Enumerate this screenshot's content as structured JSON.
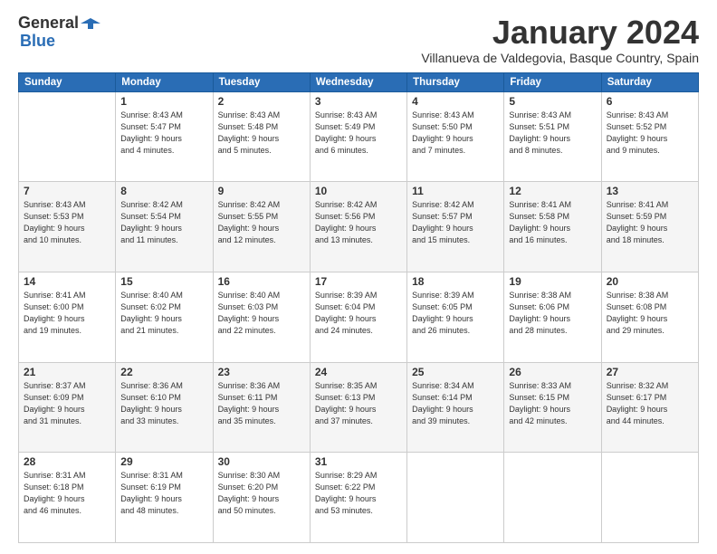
{
  "logo": {
    "line1": "General",
    "line2": "Blue"
  },
  "title": "January 2024",
  "subtitle": "Villanueva de Valdegovia, Basque Country, Spain",
  "headers": [
    "Sunday",
    "Monday",
    "Tuesday",
    "Wednesday",
    "Thursday",
    "Friday",
    "Saturday"
  ],
  "weeks": [
    [
      {
        "day": "",
        "info": ""
      },
      {
        "day": "1",
        "info": "Sunrise: 8:43 AM\nSunset: 5:47 PM\nDaylight: 9 hours\nand 4 minutes."
      },
      {
        "day": "2",
        "info": "Sunrise: 8:43 AM\nSunset: 5:48 PM\nDaylight: 9 hours\nand 5 minutes."
      },
      {
        "day": "3",
        "info": "Sunrise: 8:43 AM\nSunset: 5:49 PM\nDaylight: 9 hours\nand 6 minutes."
      },
      {
        "day": "4",
        "info": "Sunrise: 8:43 AM\nSunset: 5:50 PM\nDaylight: 9 hours\nand 7 minutes."
      },
      {
        "day": "5",
        "info": "Sunrise: 8:43 AM\nSunset: 5:51 PM\nDaylight: 9 hours\nand 8 minutes."
      },
      {
        "day": "6",
        "info": "Sunrise: 8:43 AM\nSunset: 5:52 PM\nDaylight: 9 hours\nand 9 minutes."
      }
    ],
    [
      {
        "day": "7",
        "info": "Sunrise: 8:43 AM\nSunset: 5:53 PM\nDaylight: 9 hours\nand 10 minutes."
      },
      {
        "day": "8",
        "info": "Sunrise: 8:42 AM\nSunset: 5:54 PM\nDaylight: 9 hours\nand 11 minutes."
      },
      {
        "day": "9",
        "info": "Sunrise: 8:42 AM\nSunset: 5:55 PM\nDaylight: 9 hours\nand 12 minutes."
      },
      {
        "day": "10",
        "info": "Sunrise: 8:42 AM\nSunset: 5:56 PM\nDaylight: 9 hours\nand 13 minutes."
      },
      {
        "day": "11",
        "info": "Sunrise: 8:42 AM\nSunset: 5:57 PM\nDaylight: 9 hours\nand 15 minutes."
      },
      {
        "day": "12",
        "info": "Sunrise: 8:41 AM\nSunset: 5:58 PM\nDaylight: 9 hours\nand 16 minutes."
      },
      {
        "day": "13",
        "info": "Sunrise: 8:41 AM\nSunset: 5:59 PM\nDaylight: 9 hours\nand 18 minutes."
      }
    ],
    [
      {
        "day": "14",
        "info": "Sunrise: 8:41 AM\nSunset: 6:00 PM\nDaylight: 9 hours\nand 19 minutes."
      },
      {
        "day": "15",
        "info": "Sunrise: 8:40 AM\nSunset: 6:02 PM\nDaylight: 9 hours\nand 21 minutes."
      },
      {
        "day": "16",
        "info": "Sunrise: 8:40 AM\nSunset: 6:03 PM\nDaylight: 9 hours\nand 22 minutes."
      },
      {
        "day": "17",
        "info": "Sunrise: 8:39 AM\nSunset: 6:04 PM\nDaylight: 9 hours\nand 24 minutes."
      },
      {
        "day": "18",
        "info": "Sunrise: 8:39 AM\nSunset: 6:05 PM\nDaylight: 9 hours\nand 26 minutes."
      },
      {
        "day": "19",
        "info": "Sunrise: 8:38 AM\nSunset: 6:06 PM\nDaylight: 9 hours\nand 28 minutes."
      },
      {
        "day": "20",
        "info": "Sunrise: 8:38 AM\nSunset: 6:08 PM\nDaylight: 9 hours\nand 29 minutes."
      }
    ],
    [
      {
        "day": "21",
        "info": "Sunrise: 8:37 AM\nSunset: 6:09 PM\nDaylight: 9 hours\nand 31 minutes."
      },
      {
        "day": "22",
        "info": "Sunrise: 8:36 AM\nSunset: 6:10 PM\nDaylight: 9 hours\nand 33 minutes."
      },
      {
        "day": "23",
        "info": "Sunrise: 8:36 AM\nSunset: 6:11 PM\nDaylight: 9 hours\nand 35 minutes."
      },
      {
        "day": "24",
        "info": "Sunrise: 8:35 AM\nSunset: 6:13 PM\nDaylight: 9 hours\nand 37 minutes."
      },
      {
        "day": "25",
        "info": "Sunrise: 8:34 AM\nSunset: 6:14 PM\nDaylight: 9 hours\nand 39 minutes."
      },
      {
        "day": "26",
        "info": "Sunrise: 8:33 AM\nSunset: 6:15 PM\nDaylight: 9 hours\nand 42 minutes."
      },
      {
        "day": "27",
        "info": "Sunrise: 8:32 AM\nSunset: 6:17 PM\nDaylight: 9 hours\nand 44 minutes."
      }
    ],
    [
      {
        "day": "28",
        "info": "Sunrise: 8:31 AM\nSunset: 6:18 PM\nDaylight: 9 hours\nand 46 minutes."
      },
      {
        "day": "29",
        "info": "Sunrise: 8:31 AM\nSunset: 6:19 PM\nDaylight: 9 hours\nand 48 minutes."
      },
      {
        "day": "30",
        "info": "Sunrise: 8:30 AM\nSunset: 6:20 PM\nDaylight: 9 hours\nand 50 minutes."
      },
      {
        "day": "31",
        "info": "Sunrise: 8:29 AM\nSunset: 6:22 PM\nDaylight: 9 hours\nand 53 minutes."
      },
      {
        "day": "",
        "info": ""
      },
      {
        "day": "",
        "info": ""
      },
      {
        "day": "",
        "info": ""
      }
    ]
  ]
}
